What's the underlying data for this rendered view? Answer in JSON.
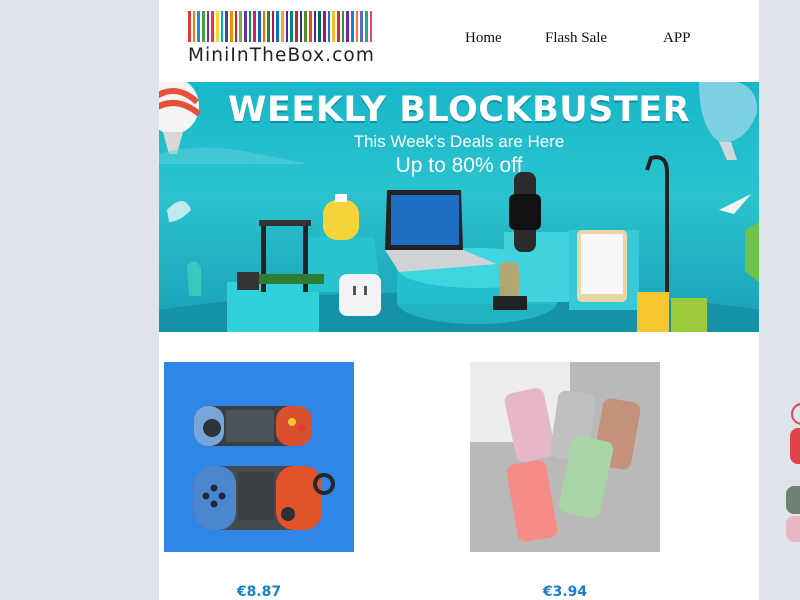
{
  "header": {
    "logo_text": "MiniInTheBox.com",
    "logo_bar_colors": [
      "#e53935",
      "#f57c00",
      "#1e88e5",
      "#43a047",
      "#8e24aa",
      "#e53935",
      "#fdd835",
      "#00acc1",
      "#3949ab",
      "#fb8c00",
      "#c62828",
      "#7cb342",
      "#5e35b1",
      "#00897b",
      "#d81b60",
      "#1565c0",
      "#ef6c00",
      "#2e7d32",
      "#ad1457",
      "#0277bd",
      "#f9a825",
      "#6a1b9a",
      "#00838f",
      "#c62828",
      "#283593",
      "#558b2f",
      "#e65100",
      "#4527a0",
      "#00695c",
      "#ad1457",
      "#1976d2",
      "#fbc02d",
      "#d32f2f",
      "#388e3c",
      "#7b1fa2",
      "#0288d1",
      "#ff7043",
      "#5c6bc0",
      "#26a69a",
      "#ec407a"
    ],
    "nav": [
      {
        "label": "Home"
      },
      {
        "label": "Flash Sale"
      },
      {
        "label": "APP"
      }
    ]
  },
  "banner": {
    "headline": "WEEKLY BLOCKBUSTER",
    "subheadline": "This Week's Deals are Here",
    "offer": "Up to 80% off"
  },
  "products": [
    {
      "price": "€8.87",
      "image": "gamepad-airpods-case-image"
    },
    {
      "price": "€3.94",
      "image": "pastel-phone-cases-image"
    }
  ],
  "colors": {
    "price": "#1b7fc4",
    "banner_bg": "#1fb4c8",
    "page_bg": "#dfe3ea"
  }
}
